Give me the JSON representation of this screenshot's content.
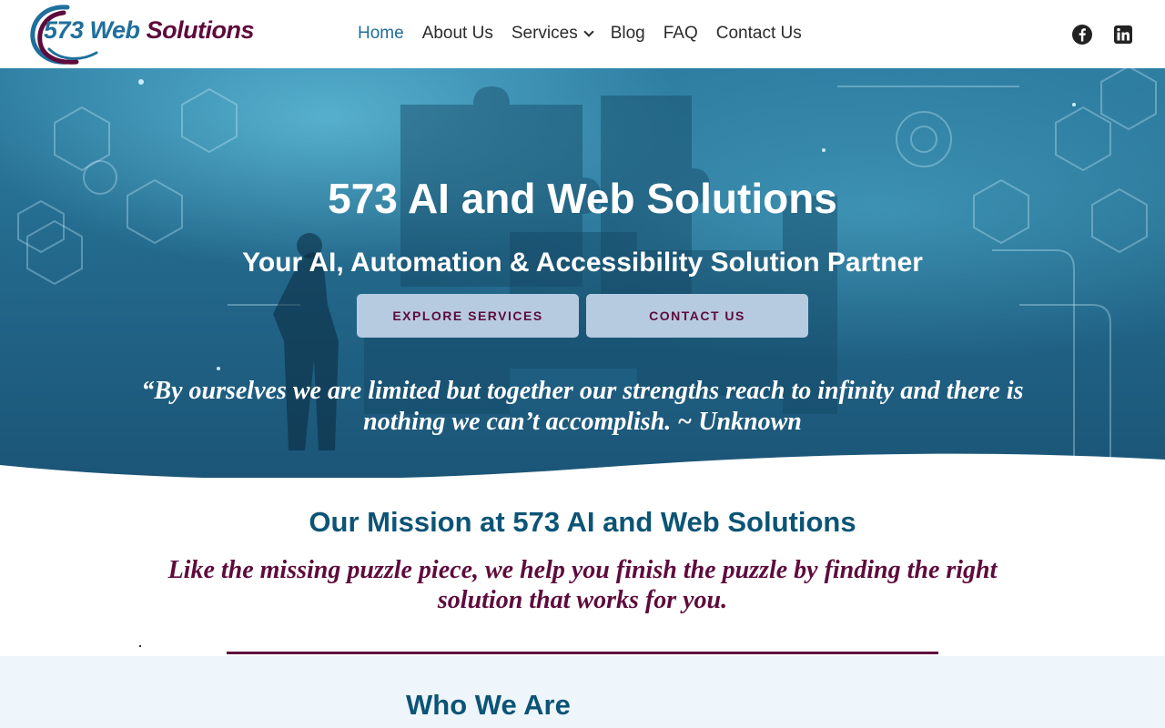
{
  "brand": {
    "logo_part1": "573 Web ",
    "logo_part2": "Solutions",
    "colors": {
      "blue": "#1f6f9c",
      "maroon": "#5e0b3c",
      "heading": "#0c5475",
      "button_bg": "#b6cbe0"
    }
  },
  "nav": {
    "items": [
      {
        "label": "Home",
        "active": true
      },
      {
        "label": "About Us",
        "active": false
      },
      {
        "label": "Services",
        "active": false,
        "dropdown": true
      },
      {
        "label": "Blog",
        "active": false
      },
      {
        "label": "FAQ",
        "active": false
      },
      {
        "label": "Contact Us",
        "active": false
      }
    ],
    "social": [
      {
        "icon": "facebook-icon"
      },
      {
        "icon": "linkedin-icon"
      }
    ]
  },
  "hero": {
    "title": "573 AI and Web Solutions",
    "subtitle": "Your AI, Automation & Accessibility Solution Partner",
    "buttons": [
      {
        "label": "EXPLORE SERVICES"
      },
      {
        "label": "CONTACT US"
      }
    ],
    "quote": "“By ourselves we are limited but together our strengths reach to infinity and there is nothing we can’t accomplish. ~ Unknown"
  },
  "mission": {
    "title": "Our Mission at 573 AI and Web Solutions",
    "text": "Like the missing puzzle piece, we help you finish the puzzle by finding the right solution that works for you."
  },
  "who": {
    "title": "Who We Are"
  }
}
